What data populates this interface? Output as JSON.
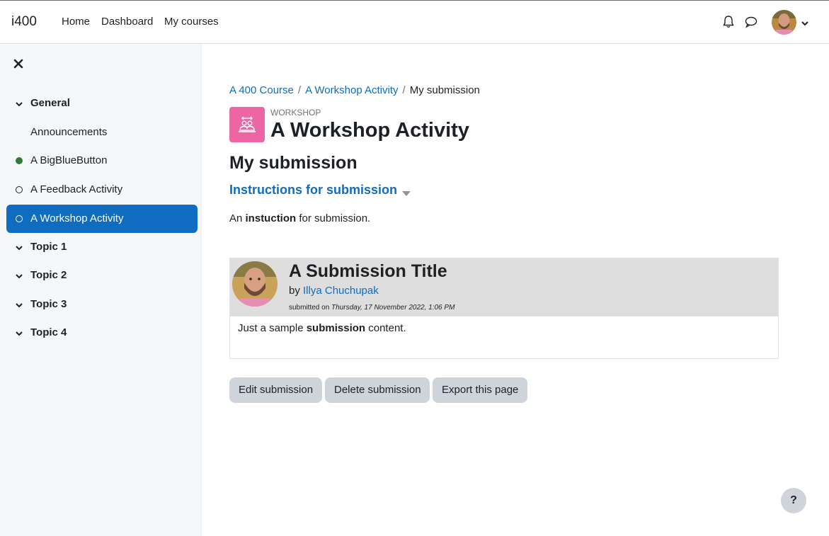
{
  "navbar": {
    "brand": "i400",
    "links": [
      "Home",
      "Dashboard",
      "My courses"
    ]
  },
  "drawer": {
    "items": [
      {
        "label": "General",
        "kind": "section"
      },
      {
        "label": "Announcements",
        "kind": "activity"
      },
      {
        "label": "A BigBlueButton",
        "kind": "activity",
        "status": "complete"
      },
      {
        "label": "A Feedback Activity",
        "kind": "activity",
        "status": "incomplete"
      },
      {
        "label": "A Workshop Activity",
        "kind": "activity",
        "status": "incomplete",
        "active": true
      },
      {
        "label": "Topic 1",
        "kind": "section"
      },
      {
        "label": "Topic 2",
        "kind": "section"
      },
      {
        "label": "Topic 3",
        "kind": "section"
      },
      {
        "label": "Topic 4",
        "kind": "section"
      }
    ]
  },
  "breadcrumb": {
    "course": "A 400 Course",
    "activity": "A Workshop Activity",
    "current": "My submission",
    "separator": "/"
  },
  "header": {
    "module_type": "WORKSHOP",
    "title": "A Workshop Activity"
  },
  "page": {
    "heading": "My submission",
    "instructions_link": "Instructions for submission",
    "instruction_pre": "An ",
    "instruction_bold": "instuction",
    "instruction_post": " for submission."
  },
  "submission": {
    "title": "A Submission Title",
    "by": "by ",
    "author": "Illya Chuchupak",
    "submitted_label": "submitted on ",
    "submitted_date": "Thursday, 17 November 2022, 1:06 PM",
    "content_pre": "Just a sample ",
    "content_bold": "submission",
    "content_post": " content."
  },
  "buttons": {
    "edit": "Edit submission",
    "delete": "Delete submission",
    "export": "Export this page"
  },
  "help": {
    "label": "?"
  },
  "colors": {
    "primary": "#0f6cbf",
    "workshop_icon": "#eb66a2",
    "complete": "#357a32"
  }
}
